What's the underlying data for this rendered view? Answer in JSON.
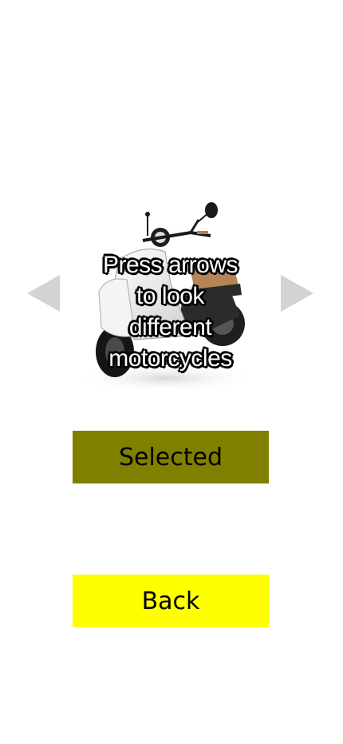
{
  "carousel": {
    "prev_icon": "triangle-left",
    "next_icon": "triangle-right",
    "image_subject": "white electric scooter",
    "overlay_text": "Press arrows\nto look\ndifferent\nmotorcycles"
  },
  "buttons": {
    "selected_label": "Selected",
    "back_label": "Back"
  },
  "colors": {
    "arrow": "#d3d3d3",
    "selected_bg": "#808000",
    "back_bg": "#ffff00",
    "page_bg": "#ffffff"
  }
}
